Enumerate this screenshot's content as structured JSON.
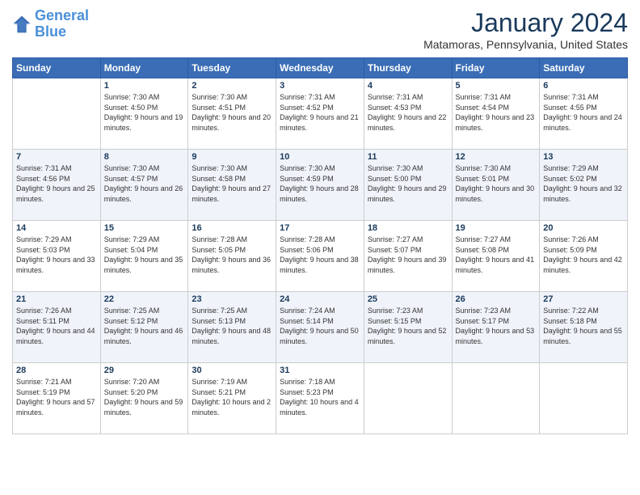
{
  "logo": {
    "line1": "General",
    "line2": "Blue"
  },
  "title": "January 2024",
  "location": "Matamoras, Pennsylvania, United States",
  "weekdays": [
    "Sunday",
    "Monday",
    "Tuesday",
    "Wednesday",
    "Thursday",
    "Friday",
    "Saturday"
  ],
  "weeks": [
    [
      {
        "day": "",
        "sunrise": "",
        "sunset": "",
        "daylight": ""
      },
      {
        "day": "1",
        "sunrise": "Sunrise: 7:30 AM",
        "sunset": "Sunset: 4:50 PM",
        "daylight": "Daylight: 9 hours and 19 minutes."
      },
      {
        "day": "2",
        "sunrise": "Sunrise: 7:30 AM",
        "sunset": "Sunset: 4:51 PM",
        "daylight": "Daylight: 9 hours and 20 minutes."
      },
      {
        "day": "3",
        "sunrise": "Sunrise: 7:31 AM",
        "sunset": "Sunset: 4:52 PM",
        "daylight": "Daylight: 9 hours and 21 minutes."
      },
      {
        "day": "4",
        "sunrise": "Sunrise: 7:31 AM",
        "sunset": "Sunset: 4:53 PM",
        "daylight": "Daylight: 9 hours and 22 minutes."
      },
      {
        "day": "5",
        "sunrise": "Sunrise: 7:31 AM",
        "sunset": "Sunset: 4:54 PM",
        "daylight": "Daylight: 9 hours and 23 minutes."
      },
      {
        "day": "6",
        "sunrise": "Sunrise: 7:31 AM",
        "sunset": "Sunset: 4:55 PM",
        "daylight": "Daylight: 9 hours and 24 minutes."
      }
    ],
    [
      {
        "day": "7",
        "sunrise": "Sunrise: 7:31 AM",
        "sunset": "Sunset: 4:56 PM",
        "daylight": "Daylight: 9 hours and 25 minutes."
      },
      {
        "day": "8",
        "sunrise": "Sunrise: 7:30 AM",
        "sunset": "Sunset: 4:57 PM",
        "daylight": "Daylight: 9 hours and 26 minutes."
      },
      {
        "day": "9",
        "sunrise": "Sunrise: 7:30 AM",
        "sunset": "Sunset: 4:58 PM",
        "daylight": "Daylight: 9 hours and 27 minutes."
      },
      {
        "day": "10",
        "sunrise": "Sunrise: 7:30 AM",
        "sunset": "Sunset: 4:59 PM",
        "daylight": "Daylight: 9 hours and 28 minutes."
      },
      {
        "day": "11",
        "sunrise": "Sunrise: 7:30 AM",
        "sunset": "Sunset: 5:00 PM",
        "daylight": "Daylight: 9 hours and 29 minutes."
      },
      {
        "day": "12",
        "sunrise": "Sunrise: 7:30 AM",
        "sunset": "Sunset: 5:01 PM",
        "daylight": "Daylight: 9 hours and 30 minutes."
      },
      {
        "day": "13",
        "sunrise": "Sunrise: 7:29 AM",
        "sunset": "Sunset: 5:02 PM",
        "daylight": "Daylight: 9 hours and 32 minutes."
      }
    ],
    [
      {
        "day": "14",
        "sunrise": "Sunrise: 7:29 AM",
        "sunset": "Sunset: 5:03 PM",
        "daylight": "Daylight: 9 hours and 33 minutes."
      },
      {
        "day": "15",
        "sunrise": "Sunrise: 7:29 AM",
        "sunset": "Sunset: 5:04 PM",
        "daylight": "Daylight: 9 hours and 35 minutes."
      },
      {
        "day": "16",
        "sunrise": "Sunrise: 7:28 AM",
        "sunset": "Sunset: 5:05 PM",
        "daylight": "Daylight: 9 hours and 36 minutes."
      },
      {
        "day": "17",
        "sunrise": "Sunrise: 7:28 AM",
        "sunset": "Sunset: 5:06 PM",
        "daylight": "Daylight: 9 hours and 38 minutes."
      },
      {
        "day": "18",
        "sunrise": "Sunrise: 7:27 AM",
        "sunset": "Sunset: 5:07 PM",
        "daylight": "Daylight: 9 hours and 39 minutes."
      },
      {
        "day": "19",
        "sunrise": "Sunrise: 7:27 AM",
        "sunset": "Sunset: 5:08 PM",
        "daylight": "Daylight: 9 hours and 41 minutes."
      },
      {
        "day": "20",
        "sunrise": "Sunrise: 7:26 AM",
        "sunset": "Sunset: 5:09 PM",
        "daylight": "Daylight: 9 hours and 42 minutes."
      }
    ],
    [
      {
        "day": "21",
        "sunrise": "Sunrise: 7:26 AM",
        "sunset": "Sunset: 5:11 PM",
        "daylight": "Daylight: 9 hours and 44 minutes."
      },
      {
        "day": "22",
        "sunrise": "Sunrise: 7:25 AM",
        "sunset": "Sunset: 5:12 PM",
        "daylight": "Daylight: 9 hours and 46 minutes."
      },
      {
        "day": "23",
        "sunrise": "Sunrise: 7:25 AM",
        "sunset": "Sunset: 5:13 PM",
        "daylight": "Daylight: 9 hours and 48 minutes."
      },
      {
        "day": "24",
        "sunrise": "Sunrise: 7:24 AM",
        "sunset": "Sunset: 5:14 PM",
        "daylight": "Daylight: 9 hours and 50 minutes."
      },
      {
        "day": "25",
        "sunrise": "Sunrise: 7:23 AM",
        "sunset": "Sunset: 5:15 PM",
        "daylight": "Daylight: 9 hours and 52 minutes."
      },
      {
        "day": "26",
        "sunrise": "Sunrise: 7:23 AM",
        "sunset": "Sunset: 5:17 PM",
        "daylight": "Daylight: 9 hours and 53 minutes."
      },
      {
        "day": "27",
        "sunrise": "Sunrise: 7:22 AM",
        "sunset": "Sunset: 5:18 PM",
        "daylight": "Daylight: 9 hours and 55 minutes."
      }
    ],
    [
      {
        "day": "28",
        "sunrise": "Sunrise: 7:21 AM",
        "sunset": "Sunset: 5:19 PM",
        "daylight": "Daylight: 9 hours and 57 minutes."
      },
      {
        "day": "29",
        "sunrise": "Sunrise: 7:20 AM",
        "sunset": "Sunset: 5:20 PM",
        "daylight": "Daylight: 9 hours and 59 minutes."
      },
      {
        "day": "30",
        "sunrise": "Sunrise: 7:19 AM",
        "sunset": "Sunset: 5:21 PM",
        "daylight": "Daylight: 10 hours and 2 minutes."
      },
      {
        "day": "31",
        "sunrise": "Sunrise: 7:18 AM",
        "sunset": "Sunset: 5:23 PM",
        "daylight": "Daylight: 10 hours and 4 minutes."
      },
      {
        "day": "",
        "sunrise": "",
        "sunset": "",
        "daylight": ""
      },
      {
        "day": "",
        "sunrise": "",
        "sunset": "",
        "daylight": ""
      },
      {
        "day": "",
        "sunrise": "",
        "sunset": "",
        "daylight": ""
      }
    ]
  ]
}
